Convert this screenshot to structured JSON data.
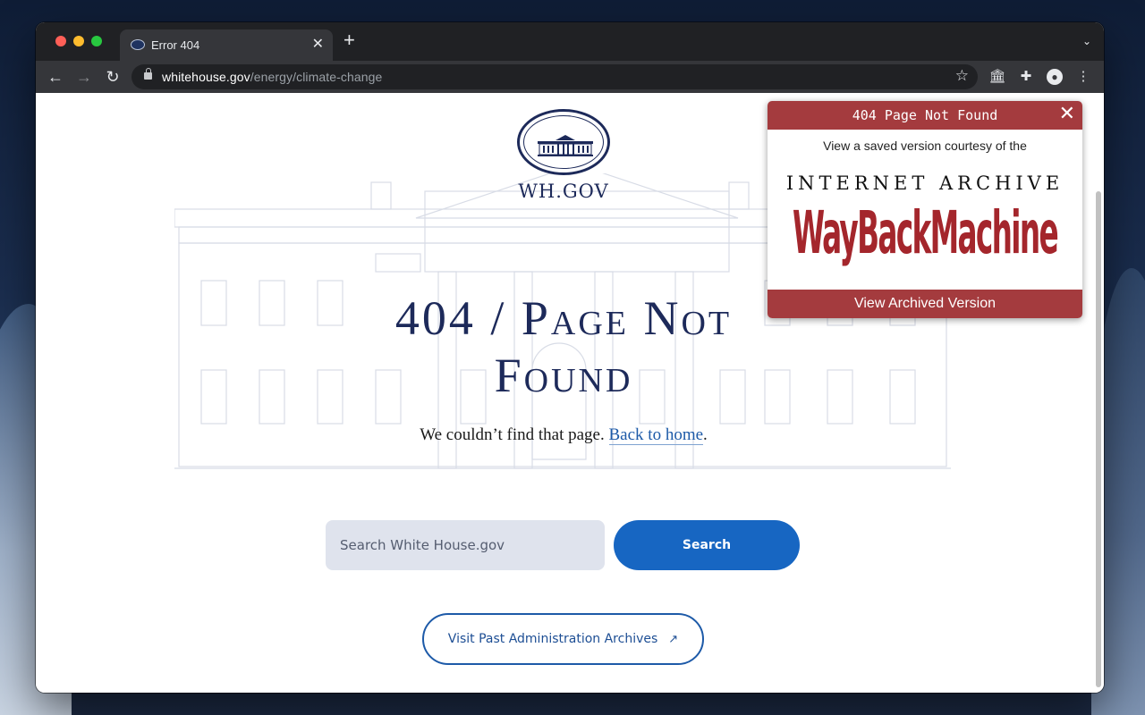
{
  "browser": {
    "tab_title": "Error 404",
    "url_host": "whitehouse.gov",
    "url_path": "/energy/climate-change"
  },
  "page": {
    "logo_text": "WH.GOV",
    "heading_line1": "404 / Page Not",
    "heading_line2": "Found",
    "subtext_before": "We couldn’t find that page. ",
    "back_home_link": "Back to home",
    "subtext_after": ".",
    "search": {
      "placeholder": "Search White House.gov",
      "button_label": "Search"
    },
    "archives_button": "Visit Past Administration Archives",
    "archives_arrow": "↗"
  },
  "wayback_popup": {
    "title": "404 Page Not Found",
    "close_label": "✕",
    "subtitle": "View a saved version courtesy of the",
    "brand_line1": "INTERNET ARCHIVE",
    "brand_logo_text": "WayBackMachine",
    "button_label": "View Archived Version",
    "accent_color": "#a43b3e"
  },
  "colors": {
    "navy": "#1d2a5a",
    "primary_blue": "#1766c2"
  }
}
